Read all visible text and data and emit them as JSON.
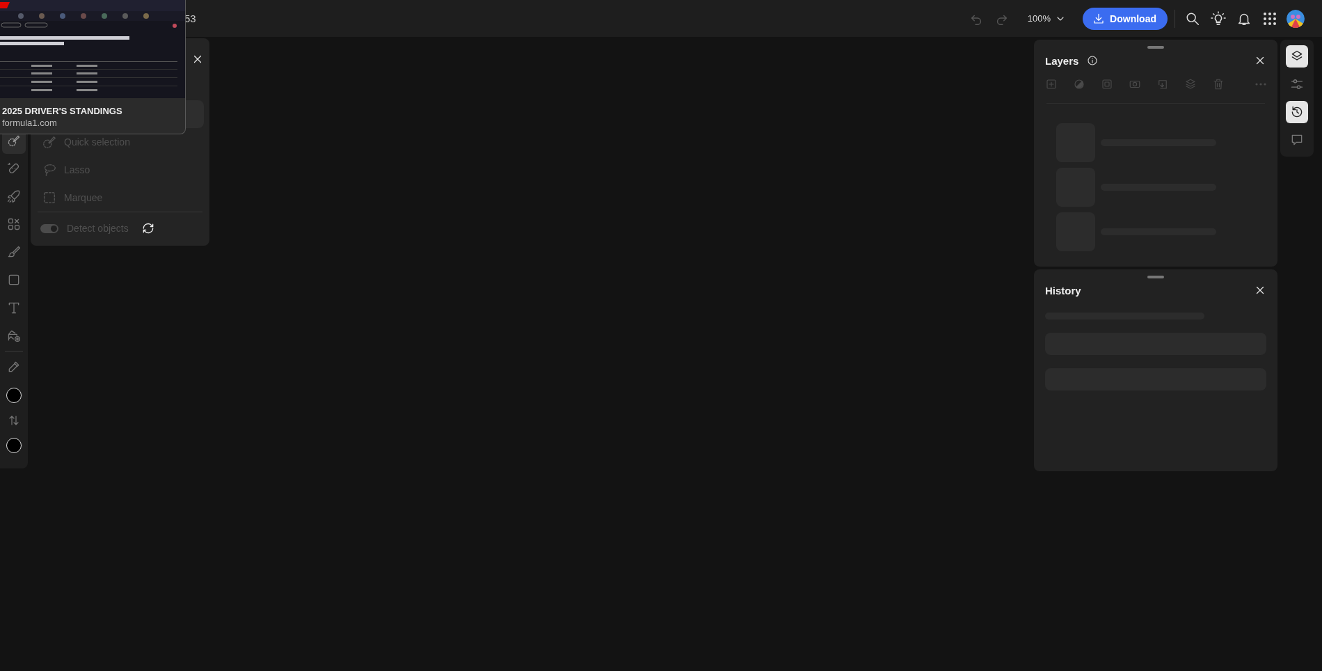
{
  "document_title": "53",
  "popup": {
    "title": "2025 DRIVER'S STANDINGS",
    "site": "formula1.com"
  },
  "top_bar": {
    "undo": {
      "disabled": true
    },
    "redo": {
      "disabled": true
    },
    "zoom": "100%",
    "download": "Download",
    "actions": [
      {
        "kind": "search"
      },
      {
        "kind": "tips"
      },
      {
        "kind": "notifications"
      },
      {
        "kind": "apps"
      },
      {
        "kind": "avatar"
      }
    ]
  },
  "tools": [
    {
      "kind": "selection",
      "selected": true
    },
    {
      "kind": "heal",
      "selected": false
    },
    {
      "kind": "quick-actions",
      "selected": false
    },
    {
      "kind": "elements",
      "selected": false
    },
    {
      "kind": "brush",
      "selected": false
    },
    {
      "kind": "shape",
      "selected": false
    },
    {
      "kind": "text",
      "selected": false
    },
    {
      "kind": "add-image",
      "selected": false
    },
    {
      "kind": "divider"
    },
    {
      "kind": "eyedropper",
      "selected": false
    },
    {
      "kind": "swatch",
      "color": "#000000"
    },
    {
      "kind": "swap"
    },
    {
      "kind": "swatch",
      "color": "#000000"
    }
  ],
  "selection_panel": {
    "items": [
      {
        "kind": "quick",
        "label": "Quick selection",
        "disabled": true
      },
      {
        "kind": "lasso",
        "label": "Lasso",
        "disabled": true
      },
      {
        "kind": "marquee",
        "label": "Marquee",
        "disabled": true
      }
    ],
    "detect": {
      "label": "Detect objects",
      "on": true,
      "disabled": true
    }
  },
  "layers": {
    "title": "Layers",
    "tools": [
      {
        "kind": "add",
        "disabled": true
      },
      {
        "kind": "mask",
        "disabled": true
      },
      {
        "kind": "frame",
        "disabled": true
      },
      {
        "kind": "clip",
        "disabled": true
      },
      {
        "kind": "arrange",
        "disabled": true
      },
      {
        "kind": "stack",
        "disabled": true
      },
      {
        "kind": "delete",
        "disabled": true
      },
      {
        "kind": "more",
        "disabled": true
      }
    ]
  },
  "history": {
    "title": "History"
  },
  "rail": [
    {
      "kind": "layers",
      "selected": true
    },
    {
      "kind": "adjust",
      "selected": false
    },
    {
      "kind": "history",
      "selected": true
    },
    {
      "kind": "comments",
      "selected": false
    }
  ]
}
